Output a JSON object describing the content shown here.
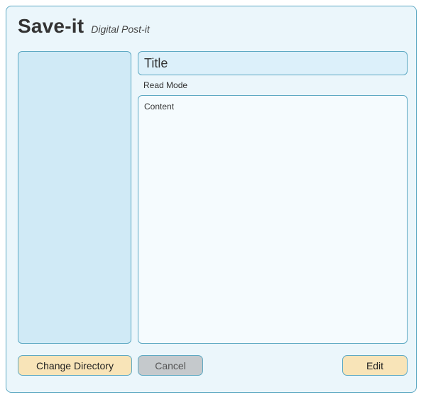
{
  "header": {
    "title": "Save-it",
    "subtitle": "Digital Post-it"
  },
  "sidebar": {
    "items": []
  },
  "note": {
    "title_placeholder": "Title",
    "mode_label": "Read Mode",
    "content_placeholder": "Content"
  },
  "buttons": {
    "change_directory": "Change Directory",
    "cancel": "Cancel",
    "edit": "Edit"
  }
}
